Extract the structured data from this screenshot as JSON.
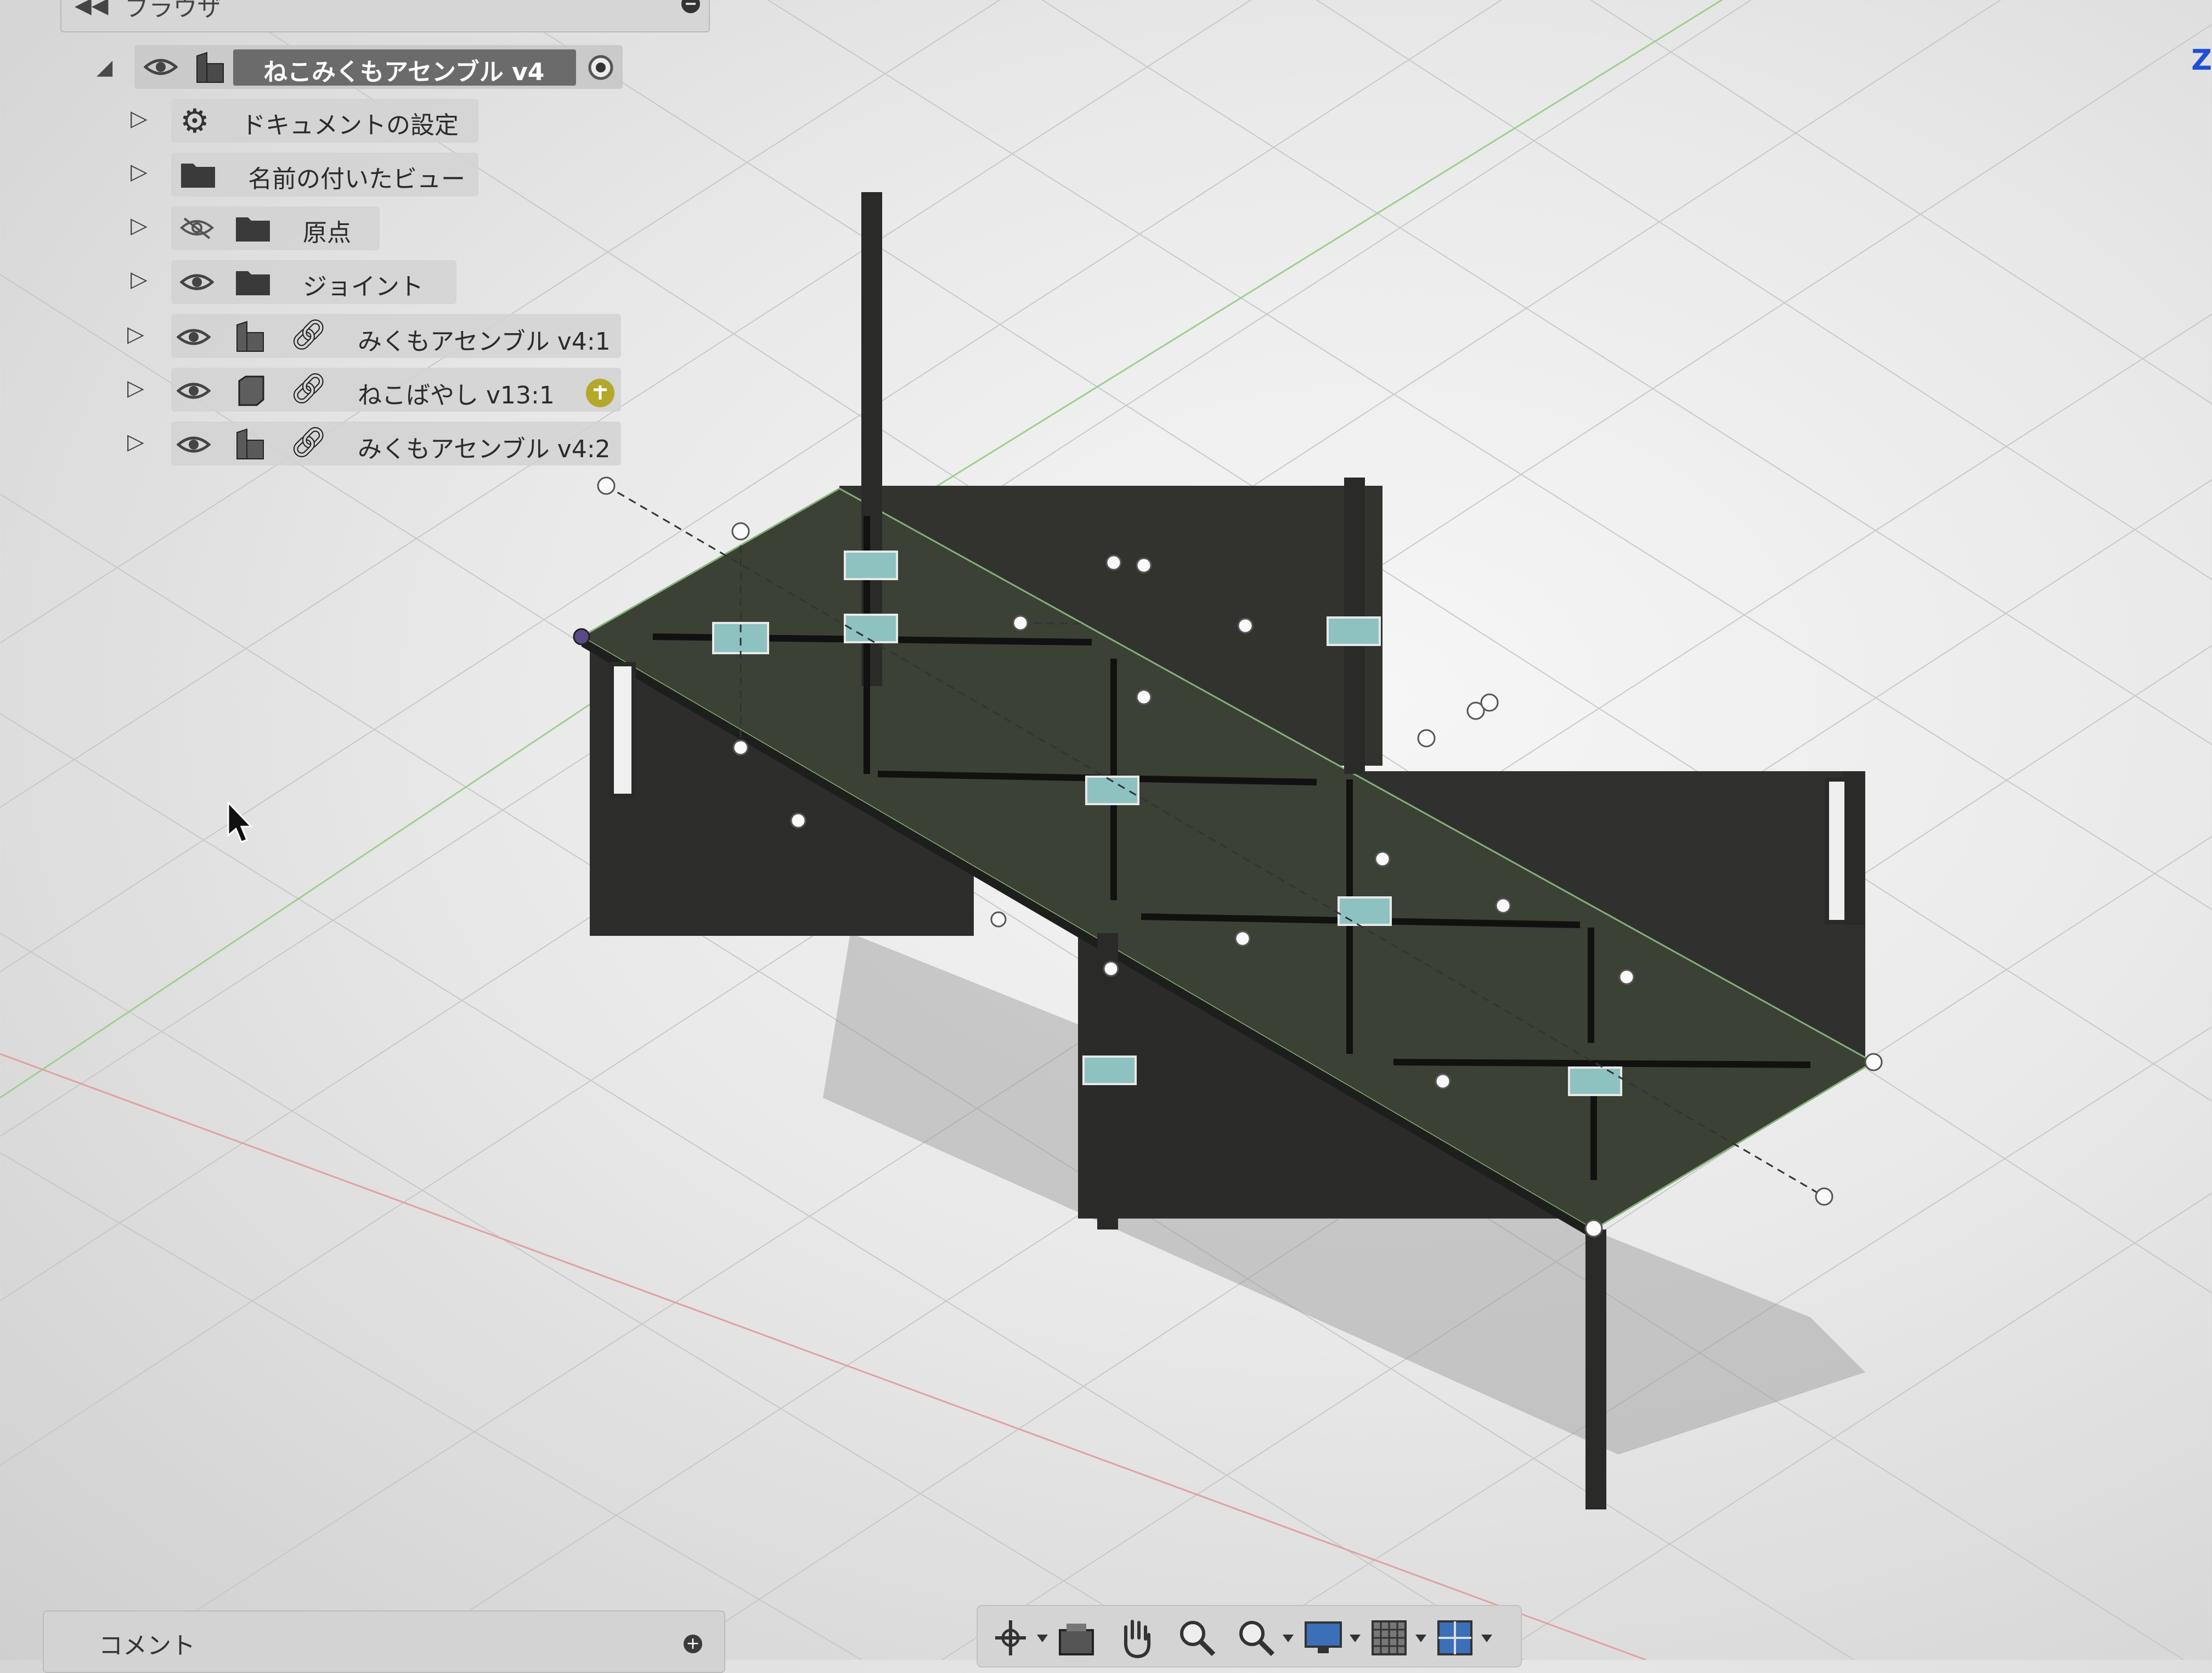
{
  "browser": {
    "title": "ブラウザ",
    "collapse_icon": "double-chevron-left-icon",
    "root": {
      "label": "ねこみくもアセンブル v4",
      "expanded": true
    },
    "items": [
      {
        "label": "ドキュメントの設定",
        "icon": "gear-icon"
      },
      {
        "label": "名前の付いたビュー",
        "icon": "folder-icon"
      },
      {
        "label": "原点",
        "icon": "folder-icon",
        "visibility": "hidden"
      },
      {
        "label": "ジョイント",
        "icon": "folder-icon",
        "visibility": "visible"
      },
      {
        "label": "みくもアセンブル v4:1",
        "icon": "component-icon",
        "linked": true,
        "visibility": "visible"
      },
      {
        "label": "ねこばやし v13:1",
        "icon": "body-icon",
        "linked": true,
        "visibility": "visible",
        "badge_color": "#b5a72a"
      },
      {
        "label": "みくもアセンブル v4:2",
        "icon": "component-icon",
        "linked": true,
        "visibility": "visible"
      }
    ]
  },
  "comments": {
    "label": "コメント",
    "add_icon": "plus-circle-icon"
  },
  "viewcube": {
    "axis_label": "Z"
  },
  "nav_toolbar": {
    "items": [
      {
        "name": "orbit",
        "icon": "orbit-icon",
        "has_dropdown": true
      },
      {
        "name": "look-at",
        "icon": "look-at-icon",
        "has_dropdown": false
      },
      {
        "name": "pan",
        "icon": "hand-pan-icon",
        "has_dropdown": false
      },
      {
        "name": "zoom",
        "icon": "zoom-icon",
        "has_dropdown": false
      },
      {
        "name": "zoom-window",
        "icon": "zoom-window-icon",
        "has_dropdown": true
      },
      {
        "name": "display-settings",
        "icon": "monitor-icon",
        "has_dropdown": true
      },
      {
        "name": "grid-settings",
        "icon": "grid-icon",
        "has_dropdown": true
      },
      {
        "name": "viewports",
        "icon": "viewports-icon",
        "has_dropdown": true
      }
    ]
  },
  "colors": {
    "model_dark": "#2e2f2c",
    "model_top": "#3f4538",
    "joint_teal": "#7fb7b7",
    "axis_green": "#8ccf7a",
    "axis_red": "#e08a8a",
    "selection": "#6b6b6b"
  }
}
